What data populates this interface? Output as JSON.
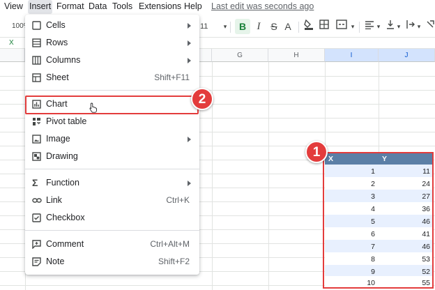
{
  "menubar": {
    "items": [
      "View",
      "Insert",
      "Format",
      "Data",
      "Tools",
      "Extensions",
      "Help"
    ],
    "last_edit": "Last edit was seconds ago"
  },
  "toolbar": {
    "zoom": "100%",
    "font_size": "11",
    "bold": "B",
    "italic": "I",
    "strike": "S",
    "text_color": "A"
  },
  "formula": {
    "name_box": "X"
  },
  "columns": [
    "G",
    "H",
    "I",
    "J"
  ],
  "table": {
    "headers": [
      "X",
      "Y"
    ],
    "rows": [
      [
        "1",
        "11"
      ],
      [
        "2",
        "24"
      ],
      [
        "3",
        "27"
      ],
      [
        "4",
        "36"
      ],
      [
        "5",
        "46"
      ],
      [
        "6",
        "41"
      ],
      [
        "7",
        "46"
      ],
      [
        "8",
        "53"
      ],
      [
        "9",
        "52"
      ],
      [
        "10",
        "55"
      ]
    ]
  },
  "insert_menu": {
    "cells": "Cells",
    "rows": "Rows",
    "columns": "Columns",
    "sheet": "Sheet",
    "sheet_shortcut": "Shift+F11",
    "chart": "Chart",
    "pivot": "Pivot table",
    "image": "Image",
    "drawing": "Drawing",
    "function": "Function",
    "link": "Link",
    "link_shortcut": "Ctrl+K",
    "checkbox": "Checkbox",
    "comment": "Comment",
    "comment_shortcut": "Ctrl+Alt+M",
    "note": "Note",
    "note_shortcut": "Shift+F2"
  },
  "callouts": {
    "step1": "1",
    "step2": "2"
  },
  "colors": {
    "highlight": "#e33c3c",
    "header_fill": "#5b7fa6",
    "band_fill": "#e8f0fe",
    "accent_green": "#188038"
  }
}
